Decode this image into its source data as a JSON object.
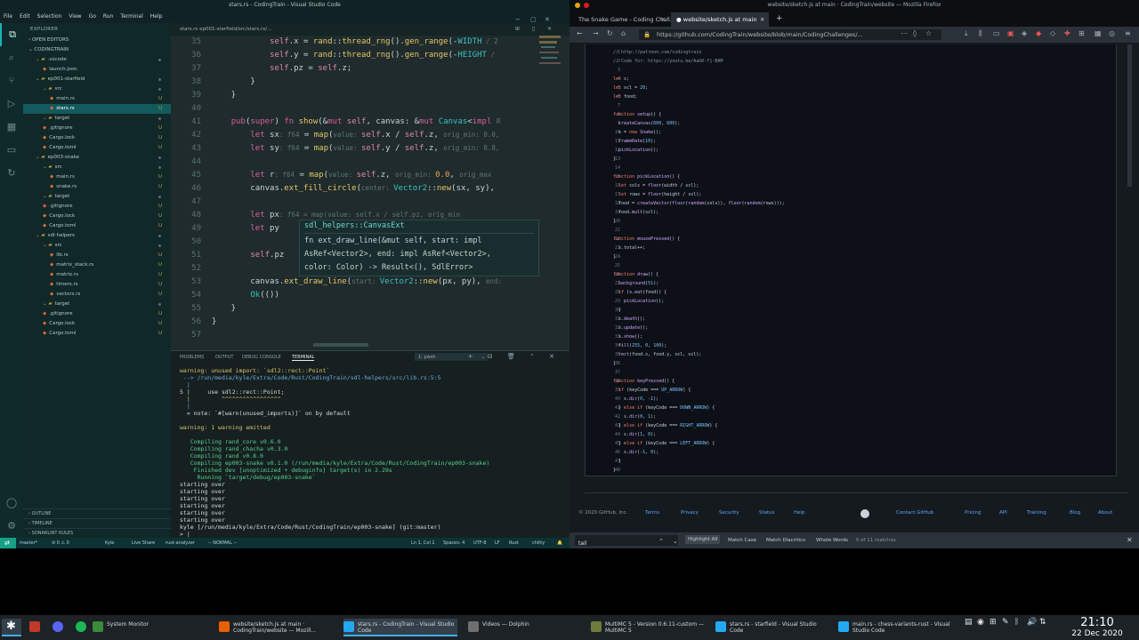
{
  "vscode": {
    "title": "stars.rs - CodingTrain - Visual Studio Code",
    "menu": [
      "File",
      "Edit",
      "Selection",
      "View",
      "Go",
      "Run",
      "Terminal",
      "Help"
    ],
    "tab_path": "stars.rs  ep001-starfield/src/stars.rs/...",
    "explorer": {
      "header": "EXPLORER",
      "open_editors": "OPEN EDITORS",
      "root": "CODINGTRAIN",
      "items": [
        {
          "label": ".vscode",
          "kind": "folder",
          "indent": 1,
          "badge": ""
        },
        {
          "label": "launch.json",
          "kind": "file",
          "indent": 2,
          "badge": ""
        },
        {
          "label": "ep001-starfield",
          "kind": "folder",
          "indent": 1,
          "badge": ""
        },
        {
          "label": "src",
          "kind": "folder",
          "indent": 2,
          "badge": ""
        },
        {
          "label": "main.rs",
          "kind": "file",
          "indent": 3,
          "badge": "U"
        },
        {
          "label": "stars.rs",
          "kind": "file",
          "indent": 3,
          "badge": "U",
          "selected": true
        },
        {
          "label": "target",
          "kind": "folder",
          "indent": 2,
          "badge": ""
        },
        {
          "label": ".gitignore",
          "kind": "git",
          "indent": 2,
          "badge": "U"
        },
        {
          "label": "Cargo.lock",
          "kind": "file",
          "indent": 2,
          "badge": "U"
        },
        {
          "label": "Cargo.toml",
          "kind": "file",
          "indent": 2,
          "badge": "U"
        },
        {
          "label": "ep003-snake",
          "kind": "folder",
          "indent": 1,
          "badge": ""
        },
        {
          "label": "src",
          "kind": "folder",
          "indent": 2,
          "badge": ""
        },
        {
          "label": "main.rs",
          "kind": "file",
          "indent": 3,
          "badge": "U"
        },
        {
          "label": "snake.rs",
          "kind": "file",
          "indent": 3,
          "badge": "U"
        },
        {
          "label": "target",
          "kind": "folder",
          "indent": 2,
          "badge": ""
        },
        {
          "label": ".gitignore",
          "kind": "git",
          "indent": 2,
          "badge": "U"
        },
        {
          "label": "Cargo.lock",
          "kind": "file",
          "indent": 2,
          "badge": "U"
        },
        {
          "label": "Cargo.toml",
          "kind": "file",
          "indent": 2,
          "badge": "U"
        },
        {
          "label": "sdl-helpers",
          "kind": "folder",
          "indent": 1,
          "badge": ""
        },
        {
          "label": "src",
          "kind": "folder",
          "indent": 2,
          "badge": ""
        },
        {
          "label": "lib.rs",
          "kind": "file",
          "indent": 3,
          "badge": "U"
        },
        {
          "label": "matrix_stack.rs",
          "kind": "file",
          "indent": 3,
          "badge": "U"
        },
        {
          "label": "matrix.rs",
          "kind": "file",
          "indent": 3,
          "badge": "U"
        },
        {
          "label": "timers.rs",
          "kind": "file",
          "indent": 3,
          "badge": "U"
        },
        {
          "label": "vectors.rs",
          "kind": "file",
          "indent": 3,
          "badge": "U"
        },
        {
          "label": "target",
          "kind": "folder",
          "indent": 2,
          "badge": ""
        },
        {
          "label": ".gitignore",
          "kind": "git",
          "indent": 2,
          "badge": "U"
        },
        {
          "label": "Cargo.lock",
          "kind": "file",
          "indent": 2,
          "badge": "U"
        },
        {
          "label": "Cargo.toml",
          "kind": "file",
          "indent": 2,
          "badge": "U"
        }
      ],
      "outline": "OUTLINE",
      "timeline": "TIMELINE",
      "sonarlint": "SONARLINT RULES"
    },
    "code_lines": [
      {
        "n": "35",
        "html": "            <span class='self'>self</span>.x = <span class='fn'>rand</span>::<span class='fn'>thread_rng</span>().<span class='fn'>gen_range</span>(-<span class='ty'>WIDTH</span><span class='hint'> / 2</span>"
      },
      {
        "n": "36",
        "html": "            <span class='self'>self</span>.y = <span class='fn'>rand</span>::<span class='fn'>thread_rng</span>().<span class='fn'>gen_range</span>(-<span class='ty'>HEIGHT</span><span class='hint'> /</span>"
      },
      {
        "n": "37",
        "html": "            <span class='self'>self</span>.pz = <span class='self'>self</span>.z;"
      },
      {
        "n": "38",
        "html": "        }"
      },
      {
        "n": "39",
        "html": "    }"
      },
      {
        "n": "40",
        "html": ""
      },
      {
        "n": "41",
        "html": "    <span class='kw'>pub</span>(<span class='kw'>super</span>) <span class='kw'>fn</span> <span class='fn'>show</span>(&amp;<span class='kw'>mut</span> <span class='self'>self</span>, canvas: &amp;<span class='kw'>mut</span> <span class='ty'>Canvas</span>&lt;<span class='kw'>impl</span> <span class='hint'>R</span>"
      },
      {
        "n": "42",
        "html": "        <span class='kw'>let</span> sx<span class='hint'>: f64</span> = <span class='fn'>map</span>(<span class='hint'>value: </span><span class='self'>self</span>.x / <span class='self'>self</span>.z, <span class='hint'>orig_min: 0.0,</span>"
      },
      {
        "n": "43",
        "html": "        <span class='kw'>let</span> sy<span class='hint'>: f64</span> = <span class='fn'>map</span>(<span class='hint'>value: </span><span class='self'>self</span>.y / <span class='self'>self</span>.z, <span class='hint'>orig_min: 0.0,</span>"
      },
      {
        "n": "44",
        "html": ""
      },
      {
        "n": "45",
        "html": "        <span class='kw'>let</span> r<span class='hint'>: f64</span> = <span class='fn'>map</span>(<span class='hint'>value: </span><span class='self'>self</span>.z, <span class='hint'>orig_min: </span><span class='num'>0.0</span>, <span class='hint'>orig_max</span>"
      },
      {
        "n": "46",
        "html": "        canvas.<span class='fn'>ext_fill_circle</span>(<span class='hint'>center: </span><span class='ty'>Vector2</span>::<span class='fn'>new</span>(sx, sy),"
      },
      {
        "n": "47",
        "html": ""
      },
      {
        "n": "48",
        "html": "        <span class='kw'>let</span> px<span class='hint'>: f64 = map(value: self.x / self.pz, orig_min</span>"
      },
      {
        "n": "49",
        "html": "        <span class='kw'>let</span> py"
      },
      {
        "n": "50",
        "html": ""
      },
      {
        "n": "51",
        "html": "        <span class='self'>self</span>.pz"
      },
      {
        "n": "52",
        "html": ""
      },
      {
        "n": "53",
        "html": "        canvas.<span class='fn'>ext_draw_line</span>(<span class='hint'>start: </span><span class='ty'>Vector2</span>::<span class='fn'>new</span>(px, py), <span class='hint'>end:</span>"
      },
      {
        "n": "54",
        "html": "        <span class='ty'>Ok</span>(())"
      },
      {
        "n": "55",
        "html": "    }"
      },
      {
        "n": "56",
        "html": "}"
      },
      {
        "n": "57",
        "html": ""
      }
    ],
    "hover": {
      "header": "sdl_helpers::CanvasExt",
      "line1": "fn ext_draw_line(&mut self, start: impl",
      "line2": "AsRef<Vector2>, end: impl AsRef<Vector2>,",
      "line3": "color: Color) -> Result<(), SdlError>"
    },
    "panel": {
      "tabs": [
        "PROBLEMS",
        "OUTPUT",
        "DEBUG CONSOLE",
        "TERMINAL"
      ],
      "terminal_select": "1: pwsh",
      "lines": [
        {
          "cls": "t-warn",
          "text": "warning: unused import: `sdl2::rect::Point`"
        },
        {
          "cls": "t-blue",
          "text": " --> /run/media/kyle/Extra/Code/Rust/CodingTrain/sdl-helpers/src/lib.rs:5:5"
        },
        {
          "cls": "t-blue",
          "text": "  |"
        },
        {
          "cls": "",
          "text": "5 |     use sdl2::rect::Point;"
        },
        {
          "cls": "t-warn",
          "text": "  |         ^^^^^^^^^^^^^^^^^"
        },
        {
          "cls": "t-blue",
          "text": "  |"
        },
        {
          "cls": "",
          "text": "  = note: `#[warn(unused_imports)]` on by default"
        },
        {
          "cls": "",
          "text": ""
        },
        {
          "cls": "t-warn",
          "text": "warning: 1 warning emitted"
        },
        {
          "cls": "",
          "text": ""
        },
        {
          "cls": "t-green",
          "text": "   Compiling rand_core v0.6.0"
        },
        {
          "cls": "t-green",
          "text": "   Compiling rand_chacha v0.3.0"
        },
        {
          "cls": "t-green",
          "text": "   Compiling rand v0.8.0"
        },
        {
          "cls": "t-green",
          "text": "   Compiling ep003-snake v0.1.0 (/run/media/kyle/Extra/Code/Rust/CodingTrain/ep003-snake)"
        },
        {
          "cls": "t-green",
          "text": "    Finished dev [unoptimized + debuginfo] target(s) in 2.29s"
        },
        {
          "cls": "t-green",
          "text": "     Running `target/debug/ep003-snake`"
        },
        {
          "cls": "",
          "text": "starting over"
        },
        {
          "cls": "",
          "text": "starting over"
        },
        {
          "cls": "",
          "text": "starting over"
        },
        {
          "cls": "",
          "text": "starting over"
        },
        {
          "cls": "",
          "text": "starting over"
        },
        {
          "cls": "",
          "text": "starting over"
        },
        {
          "cls": "",
          "text": "kyle [/run/media/kyle/Extra/Code/Rust/CodingTrain/ep003-snake] (git:master)"
        },
        {
          "cls": "",
          "text": "> |"
        }
      ]
    },
    "status": {
      "branch": "master*",
      "sync": "⊘ 0 ⚠ 0",
      "kyle": "Kyle",
      "liveshare": "Live Share",
      "analyzer": "rust-analyzer",
      "mode": "-- NORMAL --",
      "position": "Ln 1, Col 1",
      "spaces": "Spaces: 4",
      "encoding": "UTF-8",
      "eol": "LF",
      "lang": "Rust",
      "user": "chitty"
    }
  },
  "firefox": {
    "title": "website/sketch.js at main · CodingTrain/website — Mozilla Firefox",
    "tabs": [
      {
        "label": "The Snake Game - Coding Chall...",
        "active": false
      },
      {
        "label": "website/sketch.js at main",
        "active": true
      }
    ],
    "url": "https://github.com/CodingTrain/website/blob/main/CodingChallenges/...",
    "code": [
      {
        "n": "1",
        "html": "<span class='gc'>// http://patreon.com/codingtrain</span>"
      },
      {
        "n": "2",
        "html": "<span class='gc'>// Code for: https://youtu.be/AaGK-fj-BAM</span>"
      },
      {
        "n": "3",
        "html": ""
      },
      {
        "n": "4",
        "html": "<span class='gk'>let</span> s;"
      },
      {
        "n": "5",
        "html": "<span class='gk'>let</span> scl = <span class='gn'>20</span>;"
      },
      {
        "n": "6",
        "html": "<span class='gk'>let</span> food;"
      },
      {
        "n": "7",
        "html": ""
      },
      {
        "n": "8",
        "html": "<span class='gk'>function</span> <span class='gf'>setup</span>() {"
      },
      {
        "n": "9",
        "html": "  <span class='gf'>createCanvas</span>(<span class='gn'>600</span>, <span class='gn'>600</span>);"
      },
      {
        "n": "10",
        "html": "  s = <span class='gk'>new</span> <span class='gf'>Snake</span>();"
      },
      {
        "n": "11",
        "html": "  <span class='gf'>frameRate</span>(<span class='gn'>10</span>);"
      },
      {
        "n": "12",
        "html": "  <span class='gf'>pickLocation</span>();"
      },
      {
        "n": "13",
        "html": "}"
      },
      {
        "n": "14",
        "html": ""
      },
      {
        "n": "15",
        "html": "<span class='gk'>function</span> <span class='gf'>pickLocation</span>() {"
      },
      {
        "n": "16",
        "html": "  <span class='gk'>let</span> cols = <span class='gf'>floor</span>(width / scl);"
      },
      {
        "n": "17",
        "html": "  <span class='gk'>let</span> rows = <span class='gf'>floor</span>(height / scl);"
      },
      {
        "n": "18",
        "html": "  food = <span class='gf'>createVector</span>(<span class='gf'>floor</span>(<span class='gf'>random</span>(cols)), <span class='gf'>floor</span>(<span class='gf'>random</span>(rows)));"
      },
      {
        "n": "19",
        "html": "  food.<span class='gf'>mult</span>(scl);"
      },
      {
        "n": "20",
        "html": "}"
      },
      {
        "n": "21",
        "html": ""
      },
      {
        "n": "22",
        "html": "<span class='gk'>function</span> <span class='gf'>mousePressed</span>() {"
      },
      {
        "n": "23",
        "html": "  s.total++;"
      },
      {
        "n": "24",
        "html": "}"
      },
      {
        "n": "25",
        "html": ""
      },
      {
        "n": "26",
        "html": "<span class='gk'>function</span> <span class='gf'>draw</span>() {"
      },
      {
        "n": "27",
        "html": "  <span class='gf'>background</span>(<span class='gn'>51</span>);"
      },
      {
        "n": "28",
        "html": "  <span class='gk'>if</span> (s.<span class='gf'>eat</span>(food)) {"
      },
      {
        "n": "29",
        "html": "    <span class='gf'>pickLocation</span>();"
      },
      {
        "n": "30",
        "html": "  }"
      },
      {
        "n": "31",
        "html": "  s.<span class='gf'>death</span>();"
      },
      {
        "n": "32",
        "html": "  s.<span class='gf'>update</span>();"
      },
      {
        "n": "33",
        "html": "  s.<span class='gf'>show</span>();"
      },
      {
        "n": "34",
        "html": "  <span class='gf'>fill</span>(<span class='gn'>255</span>, <span class='gn'>0</span>, <span class='gn'>100</span>);"
      },
      {
        "n": "35",
        "html": "  <span class='gf'>rect</span>(food.x, food.y, scl, scl);"
      },
      {
        "n": "36",
        "html": "}"
      },
      {
        "n": "37",
        "html": ""
      },
      {
        "n": "38",
        "html": "<span class='gk'>function</span> <span class='gf'>keyPressed</span>() {"
      },
      {
        "n": "39",
        "html": "  <span class='gk'>if</span> (keyCode === <span class='gn'>UP_ARROW</span>) {"
      },
      {
        "n": "40",
        "html": "    s.<span class='gf'>dir</span>(<span class='gn'>0</span>, -<span class='gn'>1</span>);"
      },
      {
        "n": "41",
        "html": "  } <span class='gk'>else if</span> (keyCode === <span class='gn'>DOWN_ARROW</span>) {"
      },
      {
        "n": "42",
        "html": "    s.<span class='gf'>dir</span>(<span class='gn'>0</span>, <span class='gn'>1</span>);"
      },
      {
        "n": "43",
        "html": "  } <span class='gk'>else if</span> (keyCode === <span class='gn'>RIGHT_ARROW</span>) {"
      },
      {
        "n": "44",
        "html": "    s.<span class='gf'>dir</span>(<span class='gn'>1</span>, <span class='gn'>0</span>);"
      },
      {
        "n": "45",
        "html": "  } <span class='gk'>else if</span> (keyCode === <span class='gn'>LEFT_ARROW</span>) {"
      },
      {
        "n": "46",
        "html": "    s.<span class='gf'>dir</span>(-<span class='gn'>1</span>, <span class='gn'>0</span>);"
      },
      {
        "n": "47",
        "html": "  }"
      },
      {
        "n": "48",
        "html": "}"
      }
    ],
    "footer": {
      "copyright": "© 2020 GitHub, Inc.",
      "links": [
        "Terms",
        "Privacy",
        "Security",
        "Status",
        "Help",
        "Contact GitHub",
        "Pricing",
        "API",
        "Training",
        "Blog",
        "About"
      ]
    },
    "find": {
      "value": "tail",
      "highlight_all": "Highlight All",
      "match_case": "Match Case",
      "match_diacritics": "Match Diacritics",
      "whole_words": "Whole Words",
      "result": "0 of 11 matches"
    }
  },
  "taskbar": {
    "items": [
      {
        "label": "System Monitor",
        "label2": "",
        "icon_color": "#3c8a3c"
      },
      {
        "label": "website/sketch.js at main ·",
        "label2": "CodingTrain/website — Mozill...",
        "icon_color": "#e66000"
      },
      {
        "label": "stars.rs - CodingTrain - Visual Studio",
        "label2": "Code",
        "icon_color": "#23a9f2"
      },
      {
        "label": "Videos — Dolphin",
        "label2": "",
        "icon_color": "#6f6f6f"
      },
      {
        "label": "MultiMC 5 - Version 0.6.11-custom —",
        "label2": "MultiMC 5",
        "icon_color": "#6f7b3a"
      },
      {
        "label": "stars.rs - starfield - Visual Studio",
        "label2": "Code",
        "icon_color": "#23a9f2"
      },
      {
        "label": "main.rs - chess-variants-rust - Visual",
        "label2": "Studio Code",
        "icon_color": "#23a9f2"
      }
    ],
    "time": "21:10",
    "date": "22 Dec 2020"
  },
  "colors": {
    "accent": "#3daee9",
    "vscode_status": "#0c3233",
    "github_link": "#58a6ff"
  }
}
